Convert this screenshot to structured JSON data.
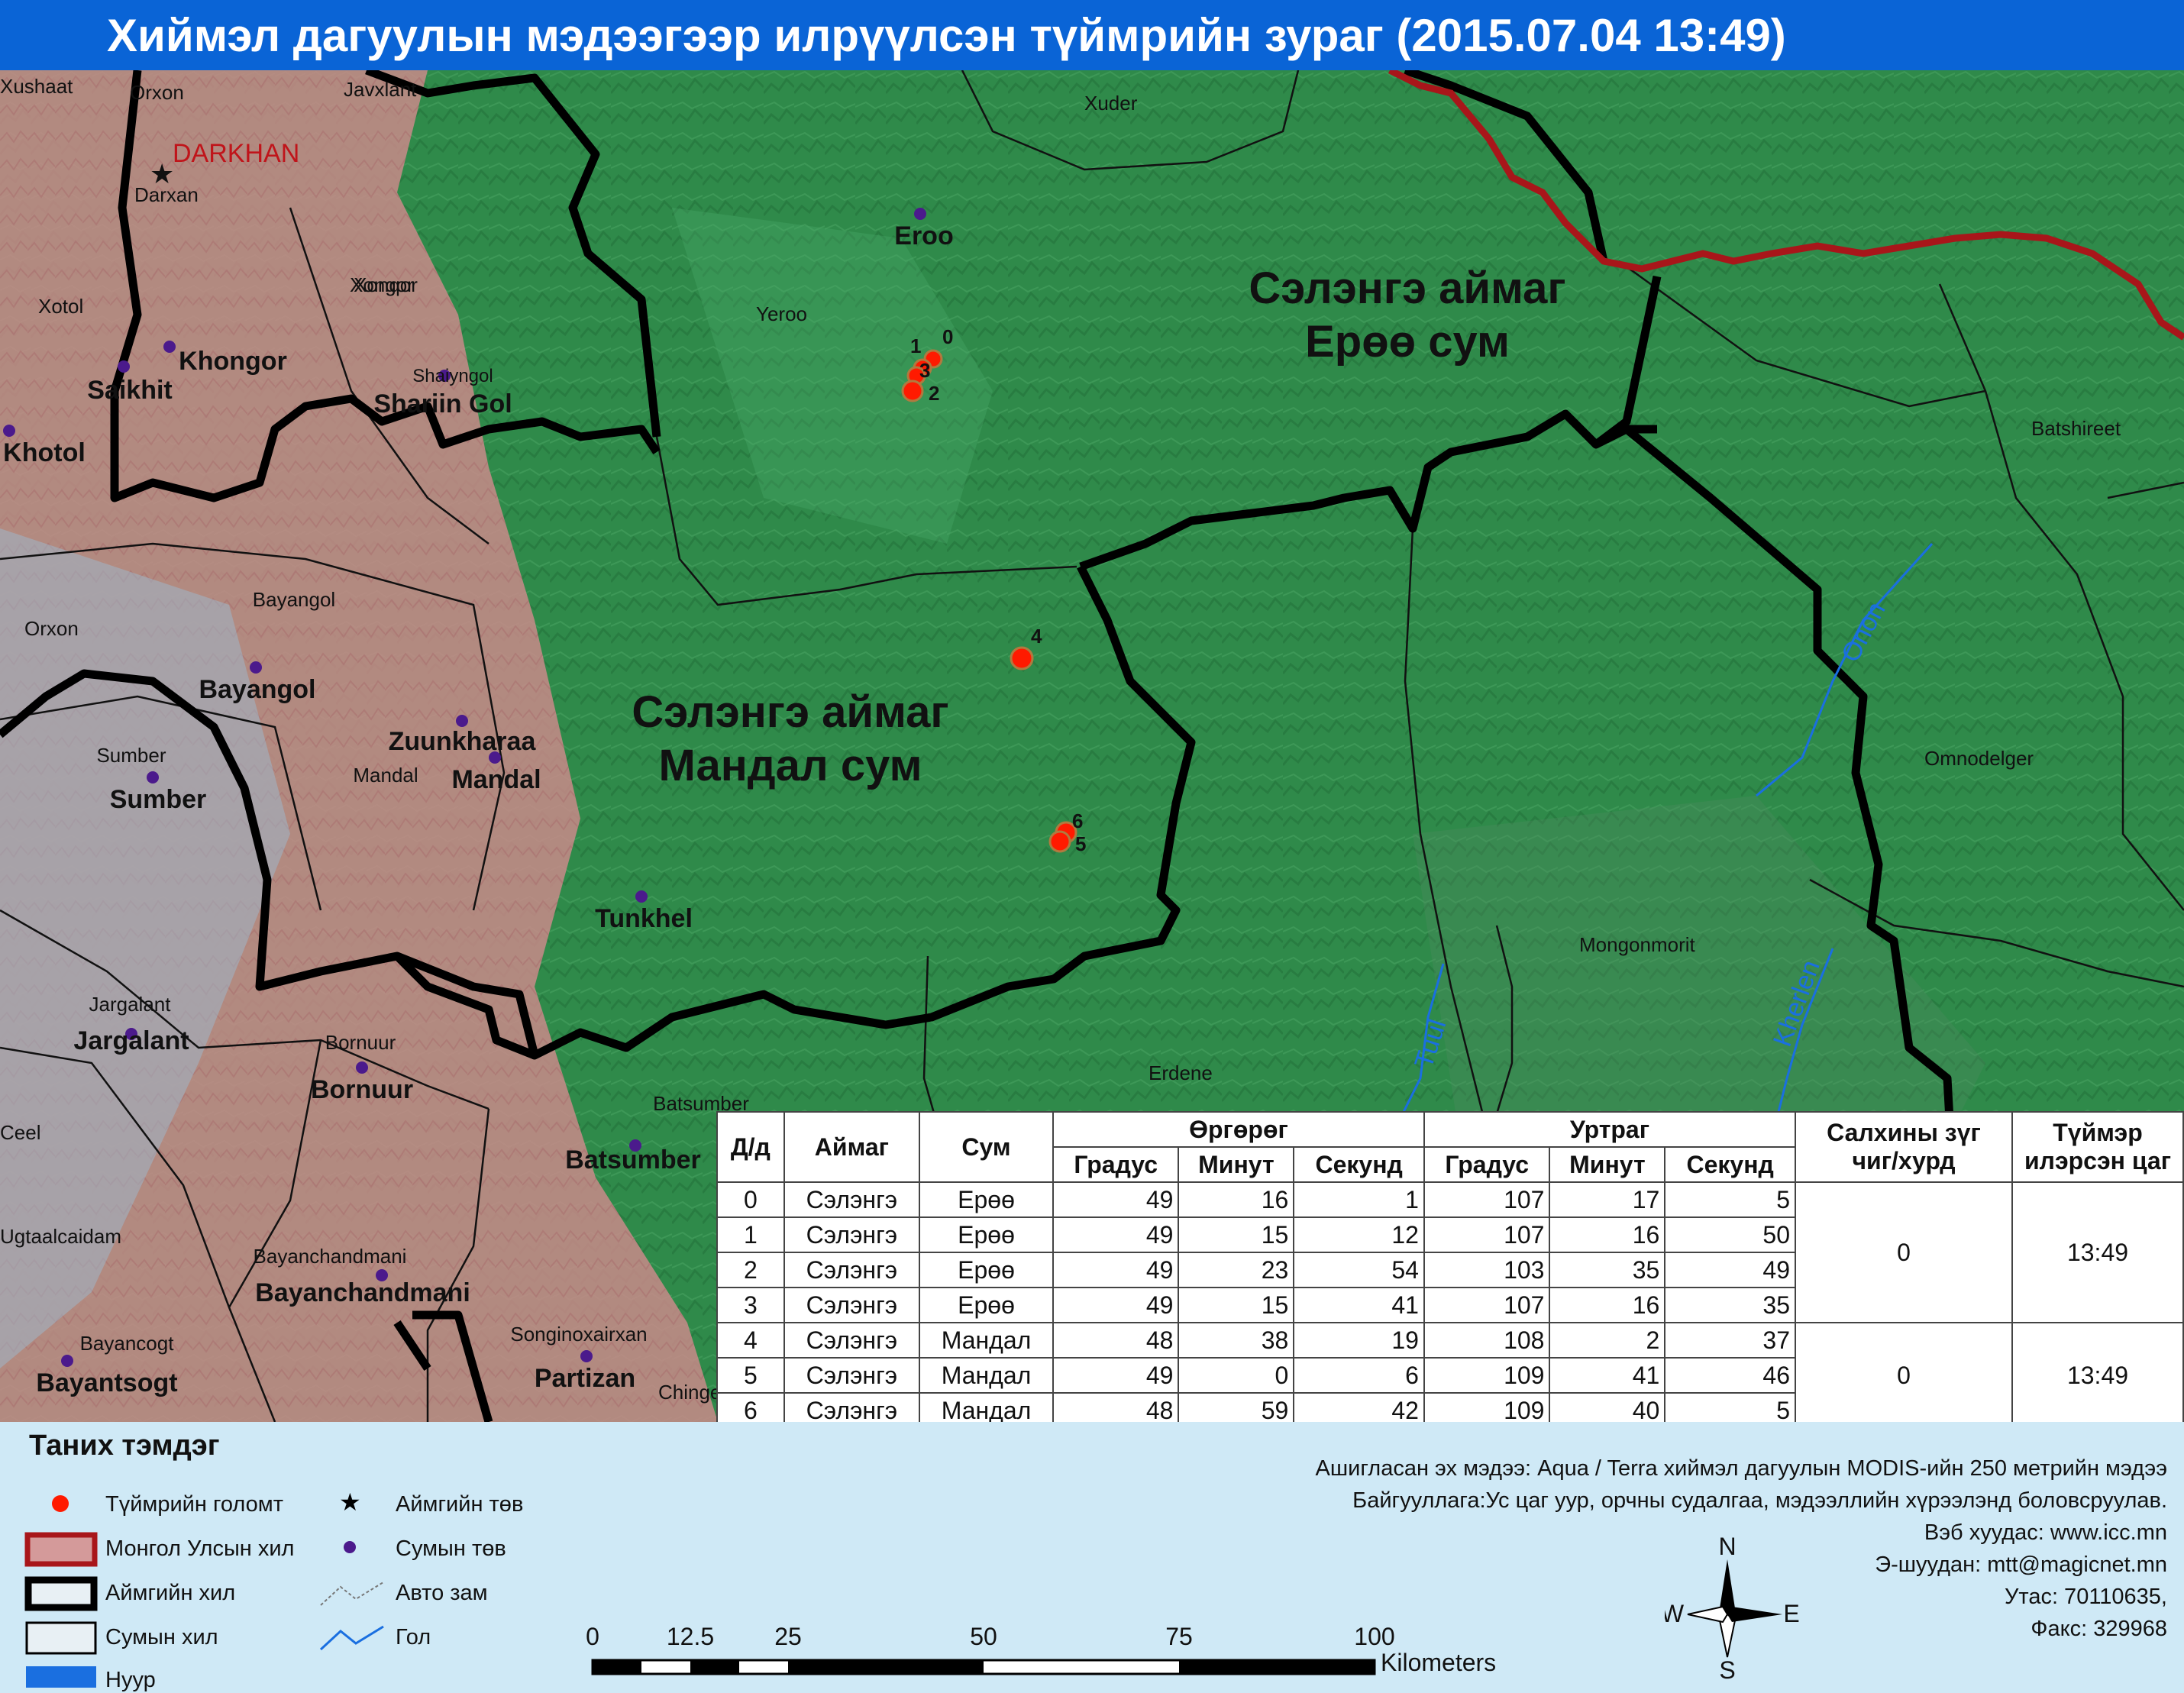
{
  "title": "Хиймэл дагуулын мэдээгээр илрүүлсэн түймрийн зураг  (2015.07.04 13:49)",
  "colors": {
    "title_bg": "#0a64d6",
    "forest": "#2f8a4a",
    "steppe": "#c98a8a",
    "fire": "#ff1a00",
    "national_border": "#a8161a",
    "aimag_border": "#000000",
    "soum_dot": "#4b1a8c",
    "river": "#1a6fe0",
    "legend_bg": "#cfe9f6"
  },
  "map": {
    "region_labels": [
      {
        "line1": "Сэлэнгэ аймаг",
        "line2": "Ерөө сум"
      },
      {
        "line1": "Сэлэнгэ аймаг",
        "line2": "Мандал сум"
      }
    ],
    "aimag_center": {
      "bold": "DARKHAN",
      "small": "Darxan"
    },
    "soum_labels": [
      {
        "small": "Eroo",
        "bold": "Eroo"
      },
      {
        "small": "Xonqor",
        "bold": "Khongor"
      },
      {
        "small": "Shaiyngol",
        "bold": "Shariin Gol"
      },
      {
        "small": "Saikhit",
        "bold": "Saikhit"
      },
      {
        "small": "Khotol",
        "bold": "Khotol"
      },
      {
        "small": "Bayangol",
        "bold": "Bayangol"
      },
      {
        "small": "Mandal",
        "bold": "Zuunkharaa"
      },
      {
        "small": "Mandal",
        "bold": "Mandal"
      },
      {
        "small": "Sumber",
        "bold": "Sumber"
      },
      {
        "small": "Tunkhel",
        "bold": "Tunkhel"
      },
      {
        "small": "Jargalant",
        "bold": "Jargalant"
      },
      {
        "small": "Bornuur",
        "bold": "Bornuur"
      },
      {
        "small": "Batsumber",
        "bold": "Batsumber"
      },
      {
        "small": "Bayanchandmani",
        "bold": "Bayanchandmani"
      },
      {
        "small": "Bayancogt",
        "bold": "Bayantsogt"
      },
      {
        "small": "Songinoxairxan",
        "bold": "Partizan"
      }
    ],
    "place_labels": [
      "Xushaat",
      "Orxon",
      "Javxlant",
      "Xuder",
      "Xotol",
      "Xongor",
      "Yeroo",
      "Orxon",
      "Batshireet",
      "Omnodelger",
      "Mongonmorit",
      "Erdene",
      "Ceel",
      "Ugtaalcaidam",
      "Chingeltei"
    ],
    "river_labels": [
      "Onon",
      "Tuul",
      "Kherlen"
    ],
    "fire_points": [
      {
        "id": "0"
      },
      {
        "id": "1"
      },
      {
        "id": "3"
      },
      {
        "id": "2"
      },
      {
        "id": "4"
      },
      {
        "id": "6"
      },
      {
        "id": "5"
      }
    ]
  },
  "table": {
    "headers": {
      "id": "Д/д",
      "aimag": "Аймаг",
      "sum": "Сум",
      "lat": "Өргөрөг",
      "lon": "Уртраг",
      "wind": "Салхины зүг чиг/хурд",
      "time": "Түймэр илэрсэн цаг",
      "deg": "Градус",
      "min": "Минут",
      "sec": "Секунд"
    },
    "rows": [
      {
        "id": "0",
        "aimag": "Сэлэнгэ",
        "sum": "Ерөө",
        "lat_d": "49",
        "lat_m": "16",
        "lat_s": "1",
        "lon_d": "107",
        "lon_m": "17",
        "lon_s": "5"
      },
      {
        "id": "1",
        "aimag": "Сэлэнгэ",
        "sum": "Ерөө",
        "lat_d": "49",
        "lat_m": "15",
        "lat_s": "12",
        "lon_d": "107",
        "lon_m": "16",
        "lon_s": "50"
      },
      {
        "id": "2",
        "aimag": "Сэлэнгэ",
        "sum": "Ерөө",
        "lat_d": "49",
        "lat_m": "23",
        "lat_s": "54",
        "lon_d": "103",
        "lon_m": "35",
        "lon_s": "49"
      },
      {
        "id": "3",
        "aimag": "Сэлэнгэ",
        "sum": "Ерөө",
        "lat_d": "49",
        "lat_m": "15",
        "lat_s": "41",
        "lon_d": "107",
        "lon_m": "16",
        "lon_s": "35"
      },
      {
        "id": "4",
        "aimag": "Сэлэнгэ",
        "sum": "Мандал",
        "lat_d": "48",
        "lat_m": "38",
        "lat_s": "19",
        "lon_d": "108",
        "lon_m": "2",
        "lon_s": "37"
      },
      {
        "id": "5",
        "aimag": "Сэлэнгэ",
        "sum": "Мандал",
        "lat_d": "49",
        "lat_m": "0",
        "lat_s": "6",
        "lon_d": "109",
        "lon_m": "41",
        "lon_s": "46"
      },
      {
        "id": "6",
        "aimag": "Сэлэнгэ",
        "sum": "Мандал",
        "lat_d": "48",
        "lat_m": "59",
        "lat_s": "42",
        "lon_d": "109",
        "lon_m": "40",
        "lon_s": "5"
      }
    ],
    "group1": {
      "wind": "0",
      "time": "13:49"
    },
    "group2": {
      "wind": "0",
      "time": "13:49"
    }
  },
  "legend": {
    "title": "Таних тэмдэг",
    "items": {
      "fire": "Түймрийн голомт",
      "national_border": "Монгол Улсын хил",
      "aimag_border": "Аймгийн хил",
      "soum_border": "Сумын хил",
      "lake": "Нуур",
      "aimag_center": "Аймгийн төв",
      "soum_center": "Сумын төв",
      "road": "Авто зам",
      "river": "Гол"
    }
  },
  "scale": {
    "ticks": [
      "0",
      "12.5",
      "25",
      "50",
      "75",
      "100"
    ],
    "unit": "Kilometers"
  },
  "compass": {
    "n": "N",
    "s": "S",
    "e": "E",
    "w": "W"
  },
  "source": {
    "line1": "Ашигласан эх мэдээ: Aqua / Terra хиймэл дагуулын MODIS-ийн 250 метрийн мэдээ",
    "line2": "Байгууллага:Ус цаг уур, орчны судалгаа, мэдээллийн хүрээлэнд боловсруулав.",
    "line3": "Вэб хуудас: www.icc.mn",
    "line4": "Э-шуудан: mtt@magicnet.mn",
    "line5": "Утас: 70110635,",
    "line6": "Факс: 329968"
  }
}
